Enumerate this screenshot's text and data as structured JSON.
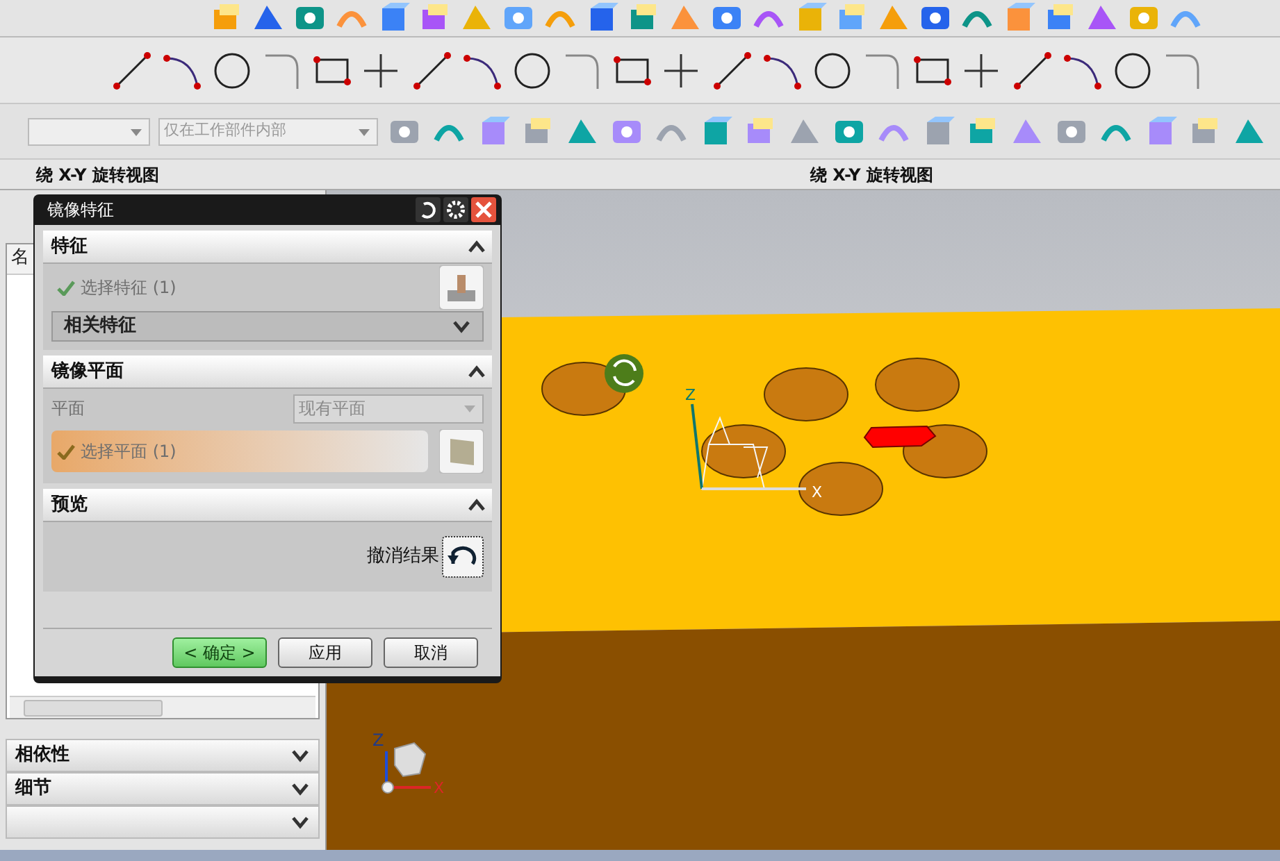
{
  "selection_bar": {
    "scope_dropdown": {
      "value": "仅在工作部件内部",
      "disabled": true
    }
  },
  "view_hints": [
    "绕 X-Y 旋转视图",
    "绕 X-Y 旋转视图"
  ],
  "part_navigator": {
    "column_1": "名",
    "sections": [
      {
        "title": "相依性",
        "expanded": false
      },
      {
        "title": "细节",
        "expanded": false
      }
    ]
  },
  "dialog": {
    "title": "镜像特征",
    "feature_group": {
      "title": "特征",
      "expanded": true,
      "select": {
        "label": "选择特征 (1)",
        "done": true,
        "active": false
      },
      "mode": "相关特征"
    },
    "plane_group": {
      "title": "镜像平面",
      "expanded": true,
      "plane_label": "平面",
      "plane_dropdown": {
        "value": "现有平面",
        "disabled": true
      },
      "select": {
        "label": "选择平面 (1)",
        "done": true,
        "active": true
      }
    },
    "preview_group": {
      "title": "预览",
      "expanded": true,
      "undo_label": "撤消结果"
    },
    "buttons": [
      {
        "label": "< 确定 >",
        "kind": "primary"
      },
      {
        "label": "应用",
        "kind": "normal"
      },
      {
        "label": "取消",
        "kind": "normal"
      }
    ]
  },
  "viewport": {
    "wcs_labels": [
      "Z",
      "X"
    ],
    "triad_labels": [
      "Z",
      "X"
    ]
  }
}
